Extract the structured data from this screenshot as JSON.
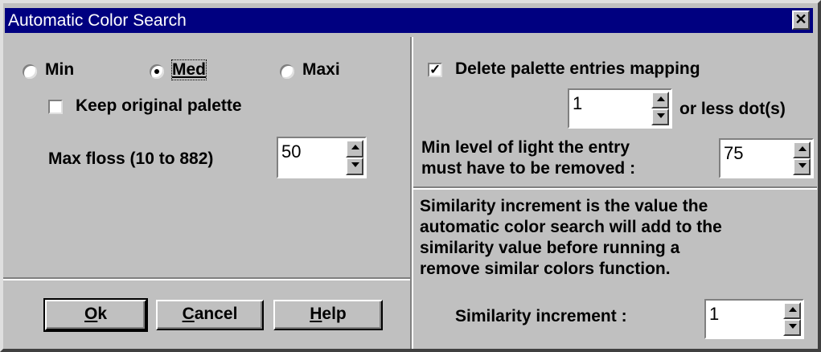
{
  "window": {
    "title": "Automatic Color Search",
    "close_symbol": "✕"
  },
  "left": {
    "radios": [
      {
        "label": "Min",
        "selected": false
      },
      {
        "label": "Med",
        "selected": true
      },
      {
        "label": "Maxi",
        "selected": false
      }
    ],
    "keep_palette": {
      "label": "Keep original palette",
      "checked": false
    },
    "max_floss": {
      "label": "Max floss (10 to 882)",
      "value": "50"
    }
  },
  "right": {
    "delete_entries": {
      "label": "Delete palette entries mapping",
      "checked": true,
      "check_mark": "✓"
    },
    "dots": {
      "value": "1",
      "suffix": "or less dot(s)"
    },
    "min_light": {
      "label_line1": "Min level of light the entry",
      "label_line2": "must have to be removed :",
      "value": "75"
    },
    "description": [
      "Similarity increment is the value the",
      "automatic color search will add to the",
      "similarity value before running a",
      "remove similar colors  function."
    ],
    "similarity": {
      "label": "Similarity increment :",
      "value": "1"
    }
  },
  "buttons": {
    "ok": {
      "mnemonic": "O",
      "rest": "k"
    },
    "cancel": {
      "mnemonic": "C",
      "rest": "ancel"
    },
    "help": {
      "mnemonic": "H",
      "rest": "elp"
    }
  }
}
